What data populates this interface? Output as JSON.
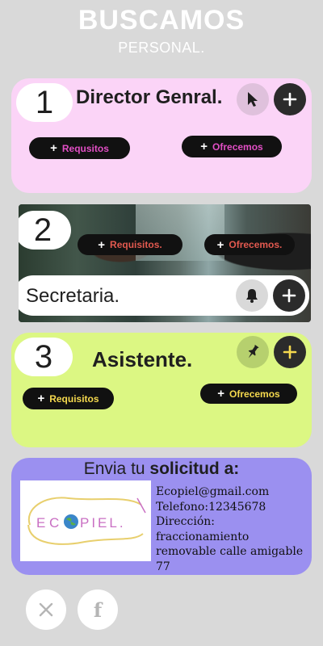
{
  "header": {
    "title": "BUSCAMOS",
    "subtitle": "PERSONAL."
  },
  "cards": [
    {
      "number": "1",
      "title": "Director Genral.",
      "icon": "cursor-icon",
      "btn_requisitos": "Requsitos",
      "btn_ofrecemos": "Ofrecemos",
      "accent": "#e24fc5"
    },
    {
      "number": "2",
      "title": "Secretaria.",
      "icon": "bell-icon",
      "btn_requisitos": "Requisitos.",
      "btn_ofrecemos": "Ofrecemos.",
      "accent": "#e2594f"
    },
    {
      "number": "3",
      "title": "Asistente.",
      "icon": "pin-icon",
      "btn_requisitos": "Requisitos",
      "btn_ofrecemos": "Ofrecemos",
      "accent": "#f5d94e"
    }
  ],
  "contact": {
    "heading_prefix": "Envia tu ",
    "heading_bold": "solicitud a:",
    "email": "Ecopiel@gmail.com",
    "phone": "Telefono:12345678",
    "address_label": "Dirección:",
    "address": "fraccionamiento removable calle amigable 77",
    "logo_text": "ECOPIEL."
  },
  "social": [
    {
      "name": "x-icon",
      "label": "X"
    },
    {
      "name": "facebook-icon",
      "label": "f"
    }
  ],
  "colors": {
    "card1": "#fbd4f7",
    "card3": "#dcf783",
    "card4": "#9b90f0",
    "page": "#d9d9d9"
  }
}
